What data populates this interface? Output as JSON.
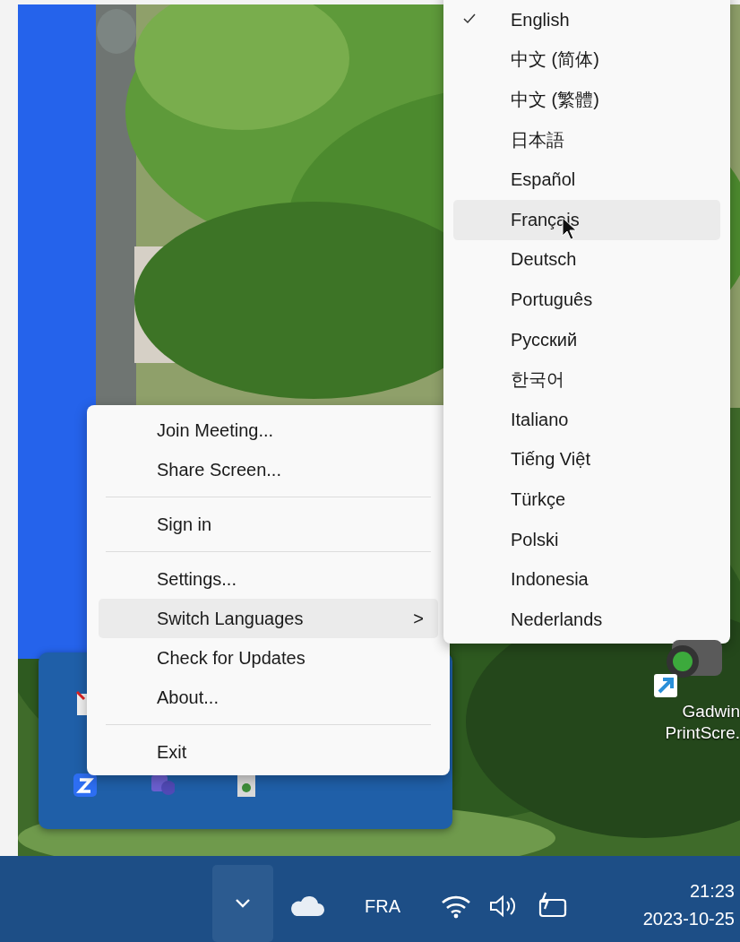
{
  "context_menu": {
    "items": [
      {
        "kind": "item",
        "label": "Join Meeting...",
        "selected": false
      },
      {
        "kind": "item",
        "label": "Share Screen...",
        "selected": false
      },
      {
        "kind": "separator"
      },
      {
        "kind": "item",
        "label": "Sign in",
        "selected": false
      },
      {
        "kind": "separator"
      },
      {
        "kind": "item",
        "label": "Settings...",
        "selected": false
      },
      {
        "kind": "submenu",
        "label": "Switch Languages",
        "arrow": ">",
        "selected": true
      },
      {
        "kind": "item",
        "label": "Check for Updates",
        "selected": false
      },
      {
        "kind": "item",
        "label": "About...",
        "selected": false
      },
      {
        "kind": "separator"
      },
      {
        "kind": "item",
        "label": "Exit",
        "selected": false
      }
    ]
  },
  "language_menu": {
    "items": [
      {
        "label": "English",
        "checked": true,
        "selected": false
      },
      {
        "label": "中文 (简体)",
        "checked": false,
        "selected": false
      },
      {
        "label": "中文 (繁體)",
        "checked": false,
        "selected": false
      },
      {
        "label": "日本語",
        "checked": false,
        "selected": false
      },
      {
        "label": "Español",
        "checked": false,
        "selected": false
      },
      {
        "label": "Français",
        "checked": false,
        "selected": true
      },
      {
        "label": "Deutsch",
        "checked": false,
        "selected": false
      },
      {
        "label": "Português",
        "checked": false,
        "selected": false
      },
      {
        "label": "Русский",
        "checked": false,
        "selected": false
      },
      {
        "label": "한국어",
        "checked": false,
        "selected": false
      },
      {
        "label": "Italiano",
        "checked": false,
        "selected": false
      },
      {
        "label": "Tiếng Việt",
        "checked": false,
        "selected": false
      },
      {
        "label": "Türkçe",
        "checked": false,
        "selected": false
      },
      {
        "label": "Polski",
        "checked": false,
        "selected": false
      },
      {
        "label": "Indonesia",
        "checked": false,
        "selected": false
      },
      {
        "label": "Nederlands",
        "checked": false,
        "selected": false
      }
    ]
  },
  "desktop_icon": {
    "label_lines": [
      "Gadwin",
      "PrintScre."
    ]
  },
  "taskbar": {
    "overflow_expanded": true,
    "language": "FRA",
    "time": "21:23",
    "date": "2023-10-25"
  }
}
